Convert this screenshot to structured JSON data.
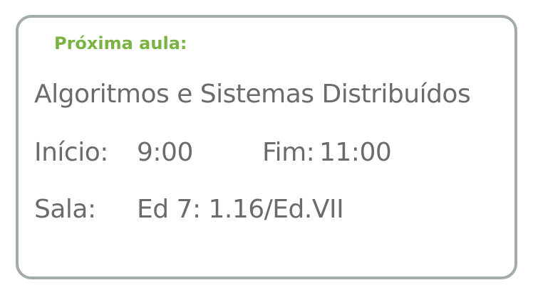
{
  "card": {
    "heading": "Próxima aula:",
    "course_name": "Algoritmos e Sistemas Distribuídos",
    "start_label": "Início:",
    "start_time": "9:00",
    "end_label": "Fim:",
    "end_time": "11:00",
    "room_label": "Sala:",
    "room_value": "Ed 7: 1.16/Ed.VII"
  },
  "colors": {
    "accent": "#7ab342",
    "text": "#6b6b6b",
    "border": "#a3acad"
  }
}
